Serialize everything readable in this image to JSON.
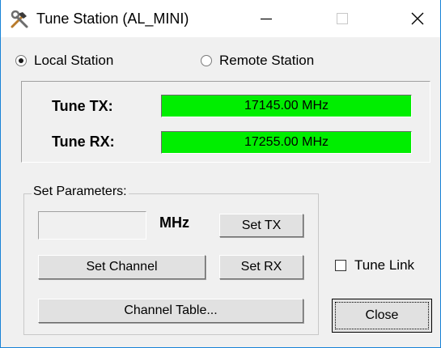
{
  "window": {
    "title": "Tune Station (AL_MINI)",
    "controls": {
      "minimize": "minimize-icon",
      "maximize": "maximize-icon",
      "close": "close-icon"
    },
    "app_icon": "hammer-wrench-icon"
  },
  "station": {
    "local_label": "Local Station",
    "remote_label": "Remote Station",
    "selected": "local"
  },
  "tune": {
    "tx_label": "Tune TX:",
    "tx_value": "17145.00 MHz",
    "rx_label": "Tune RX:",
    "rx_value": "17255.00 MHz",
    "display_color": "#00ee00"
  },
  "parameters": {
    "group_label": "Set Parameters:",
    "mhz_value": "",
    "mhz_unit": "MHz",
    "set_tx_label": "Set TX",
    "set_channel_label": "Set Channel",
    "set_rx_label": "Set RX",
    "channel_table_label": "Channel Table..."
  },
  "tune_link": {
    "label": "Tune Link",
    "checked": false
  },
  "close_label": "Close"
}
